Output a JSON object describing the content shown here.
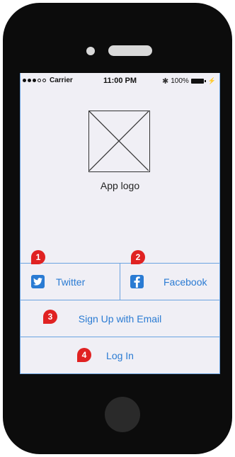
{
  "status_bar": {
    "carrier": "Carrier",
    "time": "11:00 PM",
    "battery": "100%"
  },
  "logo": {
    "label": "App logo"
  },
  "buttons": {
    "twitter": "Twitter",
    "facebook": "Facebook",
    "email": "Sign Up with Email",
    "login": "Log In"
  },
  "markers": [
    "1",
    "2",
    "3",
    "4"
  ],
  "colors": {
    "accent": "#2a7bd3",
    "marker": "#e02222",
    "screen_bg": "#f0eff5",
    "device": "#0c0c0c"
  },
  "icons": {
    "twitter": "twitter-bird-icon",
    "facebook": "facebook-f-icon",
    "bluetooth": "bluetooth-icon",
    "battery": "battery-icon"
  }
}
